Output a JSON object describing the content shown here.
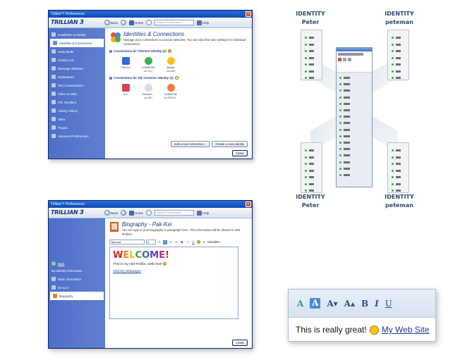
{
  "window1": {
    "title": "Trillian™ Preferences",
    "logo": "TRILLIAN",
    "logo_version": "3",
    "toolbar": {
      "back": "Back",
      "home": "Home",
      "search_placeholder": "Search Preferences",
      "help": "Help"
    },
    "sidebar": [
      "Installation & Startup",
      "Identities & Connections",
      "Away Mode",
      "Contact List",
      "Message Windows",
      "Notifications",
      "Text Conversations",
      "Video & Audio",
      "File Transfers",
      "Activity History",
      "Skins",
      "Plugins",
      "Advanced Preferences"
    ],
    "heading": "Identities & Connections",
    "description": "Manage your connections to various networks. You can also fine tune settings for individual connections.",
    "section1": "Connections for 'Pak-Kei' Identity (2)",
    "section1_conns": [
      {
        "name": "Pak-Kei",
        "net": ""
      },
      {
        "name": "123456789",
        "net": "via ICQ"
      },
      {
        "name": "fjfkdjfk",
        "net": "via AIM"
      }
    ],
    "section2": "Connections for 'My Contacts' Identity (2)",
    "section2_conns": [
      {
        "name": "Kel",
        "net": ""
      },
      {
        "name": "Rendez...",
        "net": "via IRC"
      },
      {
        "name": "KidKelPak",
        "net": "via RENO..."
      }
    ],
    "add_connection": "Add a new connection...",
    "create_identity": "Create a new Identity",
    "close": "Close"
  },
  "window2": {
    "title": "Trillian™ Preferences",
    "logo": "TRILLIAN",
    "logo_version": "3",
    "toolbar": {
      "back": "Back",
      "home": "Home",
      "search_placeholder": "Search Preferences",
      "help": "Help"
    },
    "sidebar_back": "Back",
    "sidebar_heading": "My Identity Information",
    "sidebar": [
      "Basic Information",
      "My Icon",
      "Biography"
    ],
    "heading": "Biography - Pak-Kei",
    "description": "You can type in your biography in paragraph form. This information will be shared in AIM Profiles.",
    "font": "Tahoma",
    "font_size": "9",
    "variables": "Variables",
    "welcome": "WELCOME!",
    "line": "This is my AIM Profile, Hello Kel!",
    "link": "Visit My Webpage!",
    "close": "Close"
  },
  "diagram": {
    "tl_label": "IDENTITY",
    "tl_name": "Peter",
    "tr_label": "IDENTITY",
    "tr_name": "peteman",
    "bl_label": "IDENTITY",
    "bl_name": "Peter",
    "br_label": "IDENTITY",
    "br_name": "peteman"
  },
  "zoom": {
    "text": "This is really great!",
    "link": "My Web Site"
  }
}
